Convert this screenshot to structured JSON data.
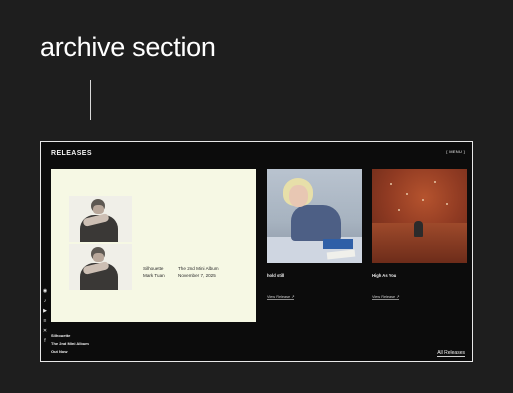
{
  "section_heading": "archive section",
  "releases": {
    "title": "RELEASES",
    "menu_label": "[ MENU ]",
    "all_releases_label": "All Releases",
    "feature": {
      "title": "Silhouette",
      "artist": "Mark Tuan",
      "album_label": "The 2nd Mini Album",
      "release_date": "November 7, 2025"
    },
    "now_text": {
      "line1": "Silhouette",
      "line2": "The 2nd Mini Album",
      "line3": "Out Now"
    },
    "social_icons": [
      {
        "glyph": "◉",
        "name": "instagram-icon"
      },
      {
        "glyph": "♪",
        "name": "tiktok-icon"
      },
      {
        "glyph": "▶",
        "name": "youtube-icon"
      },
      {
        "glyph": "≡",
        "name": "menu-grid-icon"
      },
      {
        "glyph": "✕",
        "name": "x-icon"
      },
      {
        "glyph": "f",
        "name": "facebook-icon"
      }
    ],
    "albums": [
      {
        "title": "hold still",
        "link_label": "View Release ↗"
      },
      {
        "title": "High As You",
        "link_label": "View Release ↗"
      }
    ]
  },
  "colors": {
    "page_background": "#1e1e1e",
    "panel_background": "#0c0c0c",
    "feature_background": "#f6f8e4"
  }
}
